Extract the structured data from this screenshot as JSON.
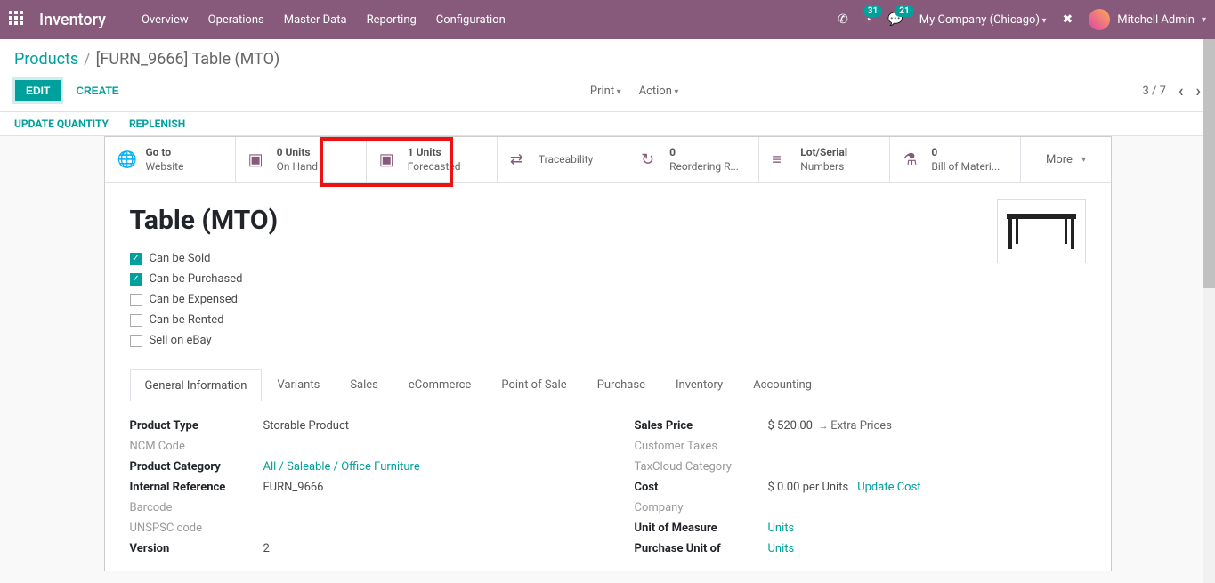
{
  "nav": {
    "brand": "Inventory",
    "menu": [
      "Overview",
      "Operations",
      "Master Data",
      "Reporting",
      "Configuration"
    ],
    "badge_activity": "31",
    "badge_discuss": "21",
    "company": "My Company (Chicago)",
    "user": "Mitchell Admin"
  },
  "breadcrumb": {
    "parent": "Products",
    "current": "[FURN_9666] Table (MTO)"
  },
  "controls": {
    "edit": "EDIT",
    "create": "CREATE",
    "print": "Print",
    "action": "Action",
    "pager": "3 / 7"
  },
  "actionbar": {
    "update_qty": "UPDATE QUANTITY",
    "replenish": "REPLENISH"
  },
  "stat": {
    "website1": "Go to",
    "website2": "Website",
    "onhand1": "0 Units",
    "onhand2": "On Hand",
    "forecast1": "1 Units",
    "forecast2": "Forecasted",
    "trace": "Traceability",
    "reorder1": "0",
    "reorder2": "Reordering R...",
    "lot1": "Lot/Serial",
    "lot2": "Numbers",
    "bom1": "0",
    "bom2": "Bill of Materi...",
    "more": "More"
  },
  "product": {
    "title": "Table (MTO)",
    "opts": {
      "sold": "Can be Sold",
      "purchased": "Can be Purchased",
      "expensed": "Can be Expensed",
      "rented": "Can be Rented",
      "ebay": "Sell on eBay"
    }
  },
  "tabs": [
    "General Information",
    "Variants",
    "Sales",
    "eCommerce",
    "Point of Sale",
    "Purchase",
    "Inventory",
    "Accounting"
  ],
  "form": {
    "left": {
      "product_type_l": "Product Type",
      "product_type_v": "Storable Product",
      "ncm_l": "NCM Code",
      "category_l": "Product Category",
      "category_v": "All / Saleable / Office Furniture",
      "internal_ref_l": "Internal Reference",
      "internal_ref_v": "FURN_9666",
      "barcode_l": "Barcode",
      "unspsc_l": "UNSPSC code",
      "version_l": "Version",
      "version_v": "2"
    },
    "right": {
      "sales_price_l": "Sales Price",
      "sales_price_v": "$ 520.00",
      "extra_prices": "Extra Prices",
      "cust_tax_l": "Customer Taxes",
      "taxcloud_l": "TaxCloud Category",
      "cost_l": "Cost",
      "cost_v": "$ 0.00",
      "cost_per": "per Units",
      "update_cost": "Update Cost",
      "company_l": "Company",
      "uom_l": "Unit of Measure",
      "uom_v": "Units",
      "puom_l": "Purchase Unit of",
      "puom_v": "Units"
    }
  }
}
